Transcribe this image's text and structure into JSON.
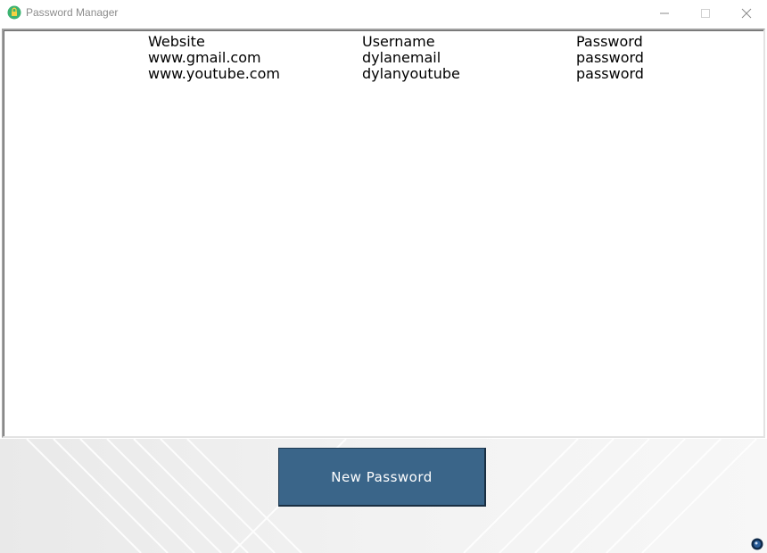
{
  "window": {
    "title": "Password Manager"
  },
  "table": {
    "headers": [
      "Website",
      "Username",
      "Password"
    ],
    "rows": [
      [
        "www.gmail.com",
        "dylanemail",
        "password"
      ],
      [
        "www.youtube.com",
        "dylanyoutube",
        "password"
      ]
    ]
  },
  "actions": {
    "new_password_label": "New Password"
  },
  "colors": {
    "button_bg": "#3a6589",
    "button_text": "#ffffff",
    "app_icon": "#3cb371"
  },
  "icons": {
    "app": "lock-icon",
    "minimize": "minimize-icon",
    "maximize": "maximize-icon",
    "close": "close-icon",
    "status": "status-dot-icon"
  }
}
